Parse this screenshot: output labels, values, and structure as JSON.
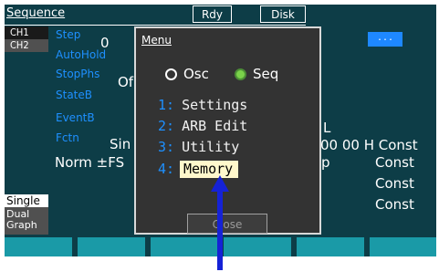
{
  "header": {
    "title": "Sequence",
    "rdy": "Rdy",
    "disk": "Disk"
  },
  "channels": {
    "ch1": "CH1",
    "ch2": "CH2"
  },
  "side": {
    "single": "Single",
    "dual_line1": "Dual",
    "dual_line2": "Graph"
  },
  "params": {
    "step": "Step",
    "step_value": "0",
    "autohold": "AutoHold",
    "stopphs": "StopPhs",
    "stopphs_value": "Of",
    "stateb": "StateB",
    "eventb": "EventB",
    "fctn": "Fctn",
    "fctn_value": "Sin",
    "norm": "Norm ±FS",
    "right_top_value": "L",
    "right_row1": "00 00 H Const",
    "right_row2_left": "p",
    "right_row2": "Const",
    "right_row3": "Const",
    "right_row4": "Const",
    "blue_block": "..."
  },
  "menu": {
    "title": "Menu",
    "radio_osc": "Osc",
    "radio_seq": "Seq",
    "items": [
      {
        "num": "1:",
        "label": "Settings"
      },
      {
        "num": "2:",
        "label": "ARB Edit"
      },
      {
        "num": "3:",
        "label": "Utility"
      },
      {
        "num": "4:",
        "label": "Memory"
      }
    ],
    "close": "Close",
    "selected_index": 3
  },
  "colors": {
    "screen_bg": "#0d3d47",
    "param_label": "#1e90ff",
    "softkey": "#1a9aa7",
    "selected_bg": "#fff8cc",
    "radio_on": "#7ad24a"
  }
}
